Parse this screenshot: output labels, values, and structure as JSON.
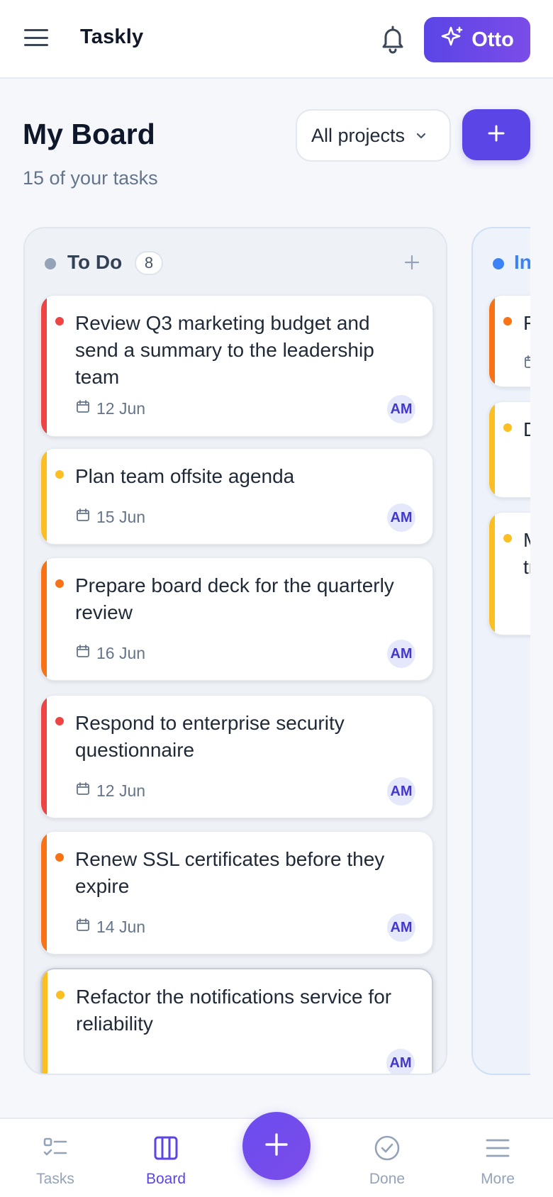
{
  "app": {
    "title": "Taskly",
    "assistant_label": "Otto",
    "accent_color": "#5b45e6"
  },
  "header": {
    "title": "My Board",
    "subtitle": "15 of your tasks",
    "project_filter": "All projects"
  },
  "columns": [
    {
      "name": "To Do",
      "count": "8",
      "dot_color": "#94a3b8",
      "cards": [
        {
          "title": "Review Q3 marketing budget and send a summary to the leadership team",
          "due": "12 Jun",
          "assignee": "AM",
          "priority_color": "#ef4444"
        },
        {
          "title": "Plan team offsite agenda",
          "due": "15 Jun",
          "assignee": "AM",
          "priority_color": "#fbbf24"
        },
        {
          "title": "Prepare board deck for the quarterly review",
          "due": "16 Jun",
          "assignee": "AM",
          "priority_color": "#f97316"
        },
        {
          "title": "Respond to enterprise security questionnaire",
          "due": "12 Jun",
          "assignee": "AM",
          "priority_color": "#ef4444"
        },
        {
          "title": "Renew SSL certificates before they expire",
          "due": "14 Jun",
          "assignee": "AM",
          "priority_color": "#f97316"
        },
        {
          "title": "Refactor the notifications service for reliability",
          "due": "",
          "assignee": "AM",
          "priority_color": "#fbbf24"
        }
      ]
    },
    {
      "name": "In",
      "dot_color": "#3b82f6",
      "cards": [
        {
          "title": "F",
          "priority_color": "#f97316"
        },
        {
          "title": "D",
          "priority_color": "#fbbf24"
        },
        {
          "title": "M",
          "title_line2": "tr",
          "priority_color": "#fbbf24"
        }
      ]
    }
  ],
  "bottom_nav": {
    "items": [
      {
        "label": "Tasks",
        "icon": "tasks-icon"
      },
      {
        "label": "Board",
        "icon": "board-icon",
        "active": true
      },
      {
        "label": "Done",
        "icon": "done-icon"
      },
      {
        "label": "More",
        "icon": "more-icon"
      }
    ],
    "fab_icon": "plus-icon"
  }
}
